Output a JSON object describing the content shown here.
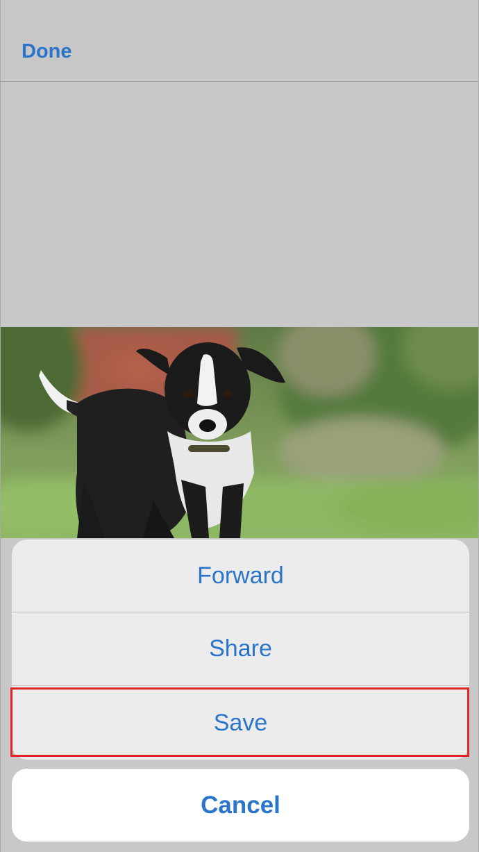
{
  "nav": {
    "done_label": "Done"
  },
  "photo": {
    "subject": "black-and-white puppy"
  },
  "action_sheet": {
    "items": [
      {
        "label": "Forward"
      },
      {
        "label": "Share"
      },
      {
        "label": "Save"
      }
    ],
    "cancel_label": "Cancel",
    "highlighted_item": "Save"
  },
  "colors": {
    "accent": "#2a75c9",
    "highlight": "#e0242a",
    "sheet_bg": "#ececec",
    "cancel_bg": "#ffffff",
    "backdrop": "#c8c8c8"
  }
}
